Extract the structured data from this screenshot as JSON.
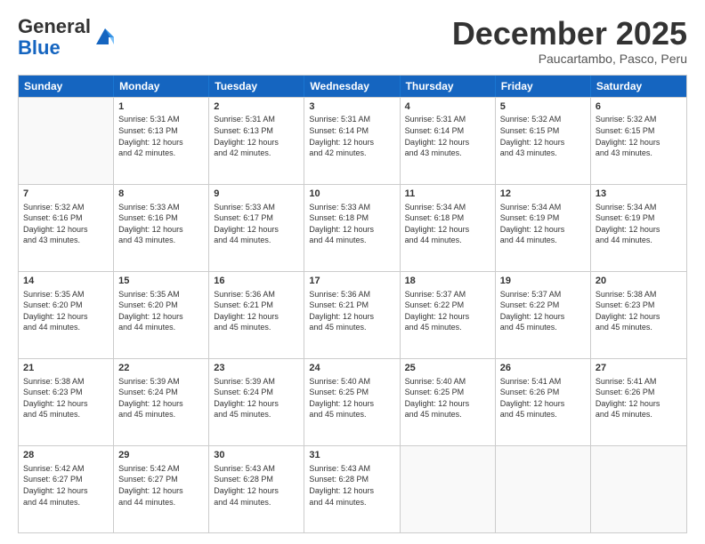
{
  "logo": {
    "general": "General",
    "blue": "Blue"
  },
  "header": {
    "month": "December 2025",
    "location": "Paucartambo, Pasco, Peru"
  },
  "days": [
    "Sunday",
    "Monday",
    "Tuesday",
    "Wednesday",
    "Thursday",
    "Friday",
    "Saturday"
  ],
  "weeks": [
    [
      {
        "day": "",
        "info": ""
      },
      {
        "day": "1",
        "info": "Sunrise: 5:31 AM\nSunset: 6:13 PM\nDaylight: 12 hours\nand 42 minutes."
      },
      {
        "day": "2",
        "info": "Sunrise: 5:31 AM\nSunset: 6:13 PM\nDaylight: 12 hours\nand 42 minutes."
      },
      {
        "day": "3",
        "info": "Sunrise: 5:31 AM\nSunset: 6:14 PM\nDaylight: 12 hours\nand 42 minutes."
      },
      {
        "day": "4",
        "info": "Sunrise: 5:31 AM\nSunset: 6:14 PM\nDaylight: 12 hours\nand 43 minutes."
      },
      {
        "day": "5",
        "info": "Sunrise: 5:32 AM\nSunset: 6:15 PM\nDaylight: 12 hours\nand 43 minutes."
      },
      {
        "day": "6",
        "info": "Sunrise: 5:32 AM\nSunset: 6:15 PM\nDaylight: 12 hours\nand 43 minutes."
      }
    ],
    [
      {
        "day": "7",
        "info": ""
      },
      {
        "day": "8",
        "info": "Sunrise: 5:33 AM\nSunset: 6:16 PM\nDaylight: 12 hours\nand 43 minutes."
      },
      {
        "day": "9",
        "info": "Sunrise: 5:33 AM\nSunset: 6:17 PM\nDaylight: 12 hours\nand 44 minutes."
      },
      {
        "day": "10",
        "info": "Sunrise: 5:33 AM\nSunset: 6:18 PM\nDaylight: 12 hours\nand 44 minutes."
      },
      {
        "day": "11",
        "info": "Sunrise: 5:34 AM\nSunset: 6:18 PM\nDaylight: 12 hours\nand 44 minutes."
      },
      {
        "day": "12",
        "info": "Sunrise: 5:34 AM\nSunset: 6:19 PM\nDaylight: 12 hours\nand 44 minutes."
      },
      {
        "day": "13",
        "info": "Sunrise: 5:34 AM\nSunset: 6:19 PM\nDaylight: 12 hours\nand 44 minutes."
      }
    ],
    [
      {
        "day": "14",
        "info": ""
      },
      {
        "day": "15",
        "info": "Sunrise: 5:35 AM\nSunset: 6:20 PM\nDaylight: 12 hours\nand 44 minutes."
      },
      {
        "day": "16",
        "info": "Sunrise: 5:36 AM\nSunset: 6:21 PM\nDaylight: 12 hours\nand 45 minutes."
      },
      {
        "day": "17",
        "info": "Sunrise: 5:36 AM\nSunset: 6:21 PM\nDaylight: 12 hours\nand 45 minutes."
      },
      {
        "day": "18",
        "info": "Sunrise: 5:37 AM\nSunset: 6:22 PM\nDaylight: 12 hours\nand 45 minutes."
      },
      {
        "day": "19",
        "info": "Sunrise: 5:37 AM\nSunset: 6:22 PM\nDaylight: 12 hours\nand 45 minutes."
      },
      {
        "day": "20",
        "info": "Sunrise: 5:38 AM\nSunset: 6:23 PM\nDaylight: 12 hours\nand 45 minutes."
      }
    ],
    [
      {
        "day": "21",
        "info": ""
      },
      {
        "day": "22",
        "info": "Sunrise: 5:39 AM\nSunset: 6:24 PM\nDaylight: 12 hours\nand 45 minutes."
      },
      {
        "day": "23",
        "info": "Sunrise: 5:39 AM\nSunset: 6:24 PM\nDaylight: 12 hours\nand 45 minutes."
      },
      {
        "day": "24",
        "info": "Sunrise: 5:40 AM\nSunset: 6:25 PM\nDaylight: 12 hours\nand 45 minutes."
      },
      {
        "day": "25",
        "info": "Sunrise: 5:40 AM\nSunset: 6:25 PM\nDaylight: 12 hours\nand 45 minutes."
      },
      {
        "day": "26",
        "info": "Sunrise: 5:41 AM\nSunset: 6:26 PM\nDaylight: 12 hours\nand 45 minutes."
      },
      {
        "day": "27",
        "info": "Sunrise: 5:41 AM\nSunset: 6:26 PM\nDaylight: 12 hours\nand 45 minutes."
      }
    ],
    [
      {
        "day": "28",
        "info": "Sunrise: 5:42 AM\nSunset: 6:27 PM\nDaylight: 12 hours\nand 44 minutes."
      },
      {
        "day": "29",
        "info": "Sunrise: 5:42 AM\nSunset: 6:27 PM\nDaylight: 12 hours\nand 44 minutes."
      },
      {
        "day": "30",
        "info": "Sunrise: 5:43 AM\nSunset: 6:28 PM\nDaylight: 12 hours\nand 44 minutes."
      },
      {
        "day": "31",
        "info": "Sunrise: 5:43 AM\nSunset: 6:28 PM\nDaylight: 12 hours\nand 44 minutes."
      },
      {
        "day": "",
        "info": ""
      },
      {
        "day": "",
        "info": ""
      },
      {
        "day": "",
        "info": ""
      }
    ]
  ],
  "week7_sunday": "Sunrise: 5:32 AM\nSunset: 6:16 PM\nDaylight: 12 hours\nand 43 minutes.",
  "week14_sunday": "Sunrise: 5:35 AM\nSunset: 6:20 PM\nDaylight: 12 hours\nand 44 minutes.",
  "week21_sunday": "Sunrise: 5:38 AM\nSunset: 6:23 PM\nDaylight: 12 hours\nand 45 minutes."
}
